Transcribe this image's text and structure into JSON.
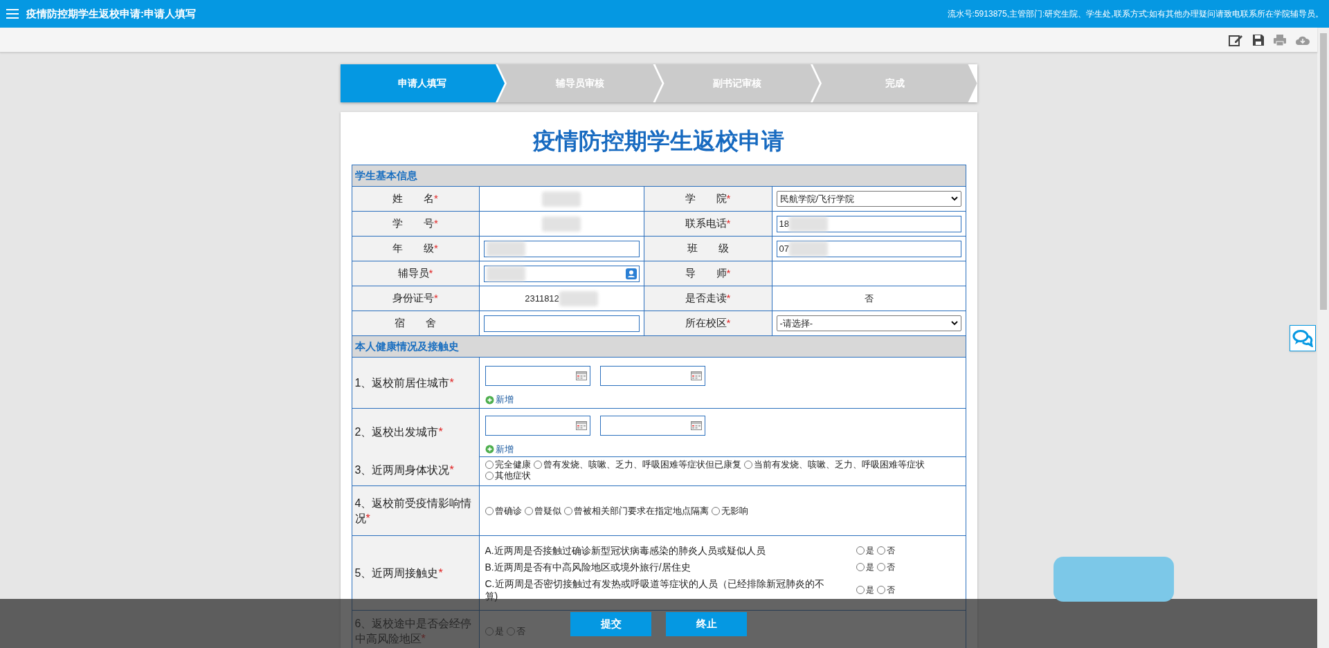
{
  "header": {
    "title": "疫情防控期学生返校申请:申请人填写",
    "info": "流水号:5913875,主管部门:研究生院、学生处,联系方式:如有其他办理疑问请致电联系所在学院辅导员。"
  },
  "steps": [
    {
      "label": "申请人填写",
      "selected": true
    },
    {
      "label": "辅导员审核",
      "selected": false
    },
    {
      "label": "副书记审核",
      "selected": false
    },
    {
      "label": "完成",
      "selected": false
    }
  ],
  "form": {
    "title": "疫情防控期学生返校申请",
    "basic_info": {
      "title": "学生基本信息",
      "rows": [
        {
          "fields": [
            {
              "label": "姓　　名",
              "required": true,
              "kind": "text",
              "blurred": true
            },
            {
              "label": "学　　院",
              "required": true,
              "kind": "select",
              "value": "民航学院/飞行学院"
            }
          ]
        },
        {
          "fields": [
            {
              "label": "学　　号",
              "required": true,
              "kind": "text",
              "blurred": true
            },
            {
              "label": "联系电话",
              "required": true,
              "kind": "input",
              "value": "18",
              "blurred": true
            }
          ]
        },
        {
          "fields": [
            {
              "label": "年　　级",
              "required": true,
              "kind": "input",
              "blurred": true
            },
            {
              "label": "班　　级",
              "required": false,
              "kind": "input",
              "value": "07",
              "blurred": true
            }
          ]
        },
        {
          "fields": [
            {
              "label": "辅导员",
              "required": true,
              "kind": "lookup",
              "blurred": true
            },
            {
              "label": "导　　师",
              "required": true,
              "kind": "text"
            }
          ]
        },
        {
          "fields": [
            {
              "label": "身份证号",
              "required": true,
              "kind": "text",
              "value": "2311812",
              "blurred": true
            },
            {
              "label": "是否走读",
              "required": true,
              "kind": "text",
              "value": "否"
            }
          ]
        },
        {
          "fields": [
            {
              "label": "宿　　舍",
              "required": false,
              "kind": "input"
            },
            {
              "label": "所在校区",
              "required": true,
              "kind": "select",
              "value": "-请选择-"
            }
          ]
        }
      ]
    },
    "health": {
      "title": "本人健康情况及接触史",
      "rows": [
        {
          "label": "1、返校前居住城市",
          "required": true,
          "kind": "city",
          "add_label": "新增"
        },
        {
          "label": "2、返校出发城市",
          "required": true,
          "kind": "city",
          "add_label": "新增"
        },
        {
          "label": "3、近两周身体状况",
          "required": true,
          "kind": "radio",
          "options": [
            {
              "label": "完全健康",
              "selected": false
            },
            {
              "label": "曾有发烧、咳嗽、乏力、呼吸困难等症状但已康复",
              "selected": false
            },
            {
              "label": "当前有发烧、咳嗽、乏力、呼吸困难等症状",
              "selected": false
            },
            {
              "label": "其他症状",
              "selected": false
            }
          ]
        },
        {
          "label": "4、返校前受疫情影响情况",
          "required": true,
          "kind": "radio",
          "options": [
            {
              "label": "曾确诊",
              "selected": false
            },
            {
              "label": "曾疑似",
              "selected": false
            },
            {
              "label": "曾被相关部门要求在指定地点隔离",
              "selected": false
            },
            {
              "label": "无影响",
              "selected": false
            }
          ]
        },
        {
          "label": "5、近两周接触史",
          "required": true,
          "kind": "questions",
          "questions": [
            {
              "text": "A.近两周是否接触过确诊新型冠状病毒感染的肺炎人员或疑似人员",
              "options": [
                {
                  "label": "是",
                  "selected": false
                },
                {
                  "label": "否",
                  "selected": false
                }
              ]
            },
            {
              "text": "B.近两周是否有中高风险地区或境外旅行/居住史",
              "options": [
                {
                  "label": "是",
                  "selected": false
                },
                {
                  "label": "否",
                  "selected": false
                }
              ]
            },
            {
              "text": "C.近两周是否密切接触过有发热或呼吸道等症状的人员（已经排除新冠肺炎的不算)",
              "options": [
                {
                  "label": "是",
                  "selected": false
                },
                {
                  "label": "否",
                  "selected": false
                }
              ]
            }
          ]
        },
        {
          "label": "6、返校途中是否会经停中高风险地区",
          "required": true,
          "kind": "radio",
          "options": [
            {
              "label": "是",
              "selected": false
            },
            {
              "label": "否",
              "selected": false
            }
          ]
        }
      ]
    }
  },
  "footer_buttons": [
    "提交",
    "终止"
  ],
  "required_mark": "*"
}
